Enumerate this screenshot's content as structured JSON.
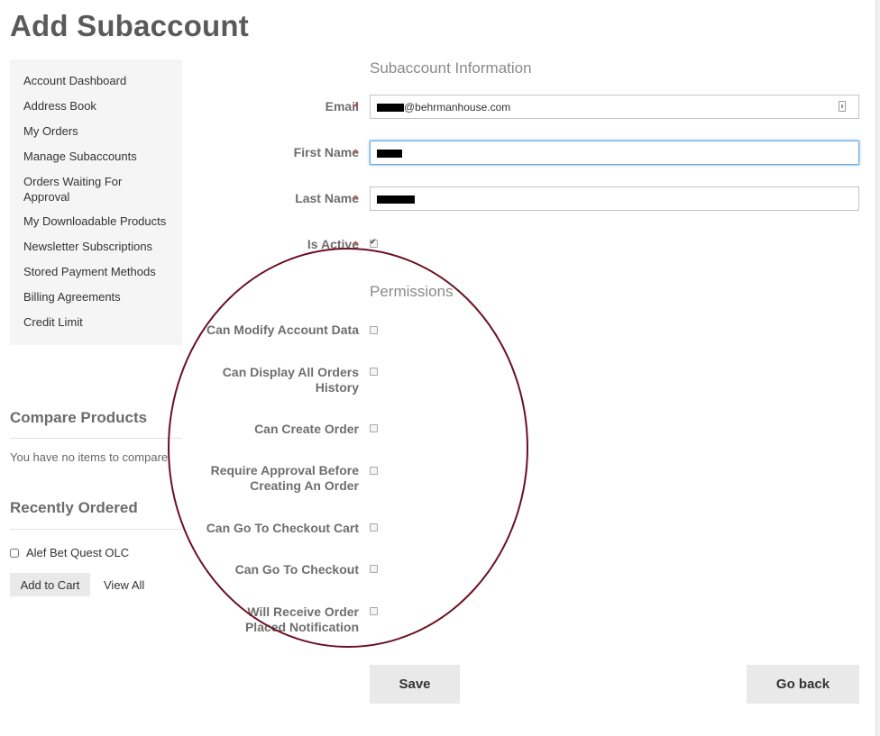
{
  "page": {
    "title": "Add Subaccount"
  },
  "sidebar": {
    "items": [
      {
        "label": "Account Dashboard"
      },
      {
        "label": "Address Book"
      },
      {
        "label": "My Orders"
      },
      {
        "label": "Manage Subaccounts"
      },
      {
        "label": "Orders Waiting For Approval"
      },
      {
        "label": "My Downloadable Products"
      },
      {
        "label": "Newsletter Subscriptions"
      },
      {
        "label": "Stored Payment Methods"
      },
      {
        "label": "Billing Agreements"
      },
      {
        "label": "Credit Limit"
      }
    ]
  },
  "compare": {
    "title": "Compare Products",
    "empty_text": "You have no items to compare."
  },
  "recently_ordered": {
    "title": "Recently Ordered",
    "item_label": "Alef Bet Quest OLC",
    "add_to_cart_label": "Add to Cart",
    "view_all_label": "View All"
  },
  "form": {
    "info_title": "Subaccount Information",
    "required_marker": "*",
    "email_label": "Email",
    "email_value": "@behrmanhouse.com",
    "first_name_label": "First Name",
    "last_name_label": "Last Name",
    "is_active_label": "Is Active",
    "is_active_checked": true,
    "permissions_title": "Permissions",
    "permissions": [
      {
        "label": "Can Modify Account Data",
        "checked": false
      },
      {
        "label": "Can Display All Orders History",
        "checked": false
      },
      {
        "label": "Can Create Order",
        "checked": false
      },
      {
        "label": "Require Approval Before Creating An Order",
        "checked": false
      },
      {
        "label": "Can Go To Checkout Cart",
        "checked": false
      },
      {
        "label": "Can Go To Checkout",
        "checked": false
      },
      {
        "label": "Will Receive Order Placed Notification",
        "checked": false
      }
    ],
    "save_label": "Save",
    "go_back_label": "Go back"
  },
  "annotation": {
    "oval_color": "#6b1023"
  },
  "icons": {
    "email_field_icon": "contact-card-icon",
    "checkmark": "checkmark-icon"
  }
}
